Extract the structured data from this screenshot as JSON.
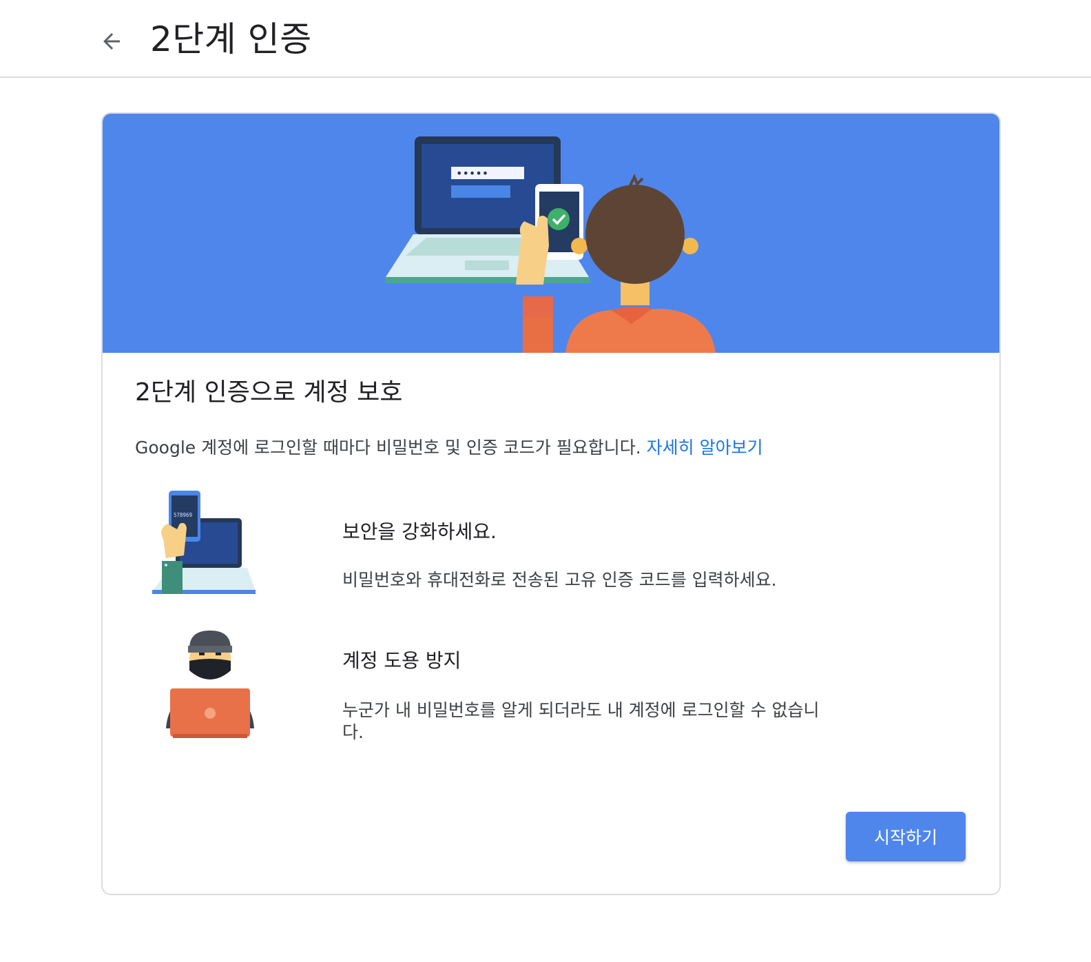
{
  "header": {
    "back_icon": "arrow-left-icon",
    "title": "2단계 인증"
  },
  "card": {
    "heading": "2단계 인증으로 계정 보호",
    "description": "Google 계정에 로그인할 때마다 비밀번호 및 인증 코드가 필요합니다.",
    "learn_more": "자세히 알아보기",
    "hero": {
      "password_mask": "•••••"
    },
    "features": [
      {
        "icon": "phone-code-laptop-illustration",
        "code": "578969",
        "title": "보안을 강화하세요.",
        "description": "비밀번호와 휴대전화로 전송된 고유 인증 코드를 입력하세요."
      },
      {
        "icon": "hacker-illustration",
        "title": "계정 도용 방지",
        "description": "누군가 내 비밀번호를 알게 되더라도 내 계정에 로그인할 수 없습니다."
      }
    ],
    "start_button": "시작하기"
  },
  "colors": {
    "accent": "#4f86ec",
    "link": "#1a73e8",
    "shirt": "#f07a4a",
    "hair": "#6d4c41"
  }
}
